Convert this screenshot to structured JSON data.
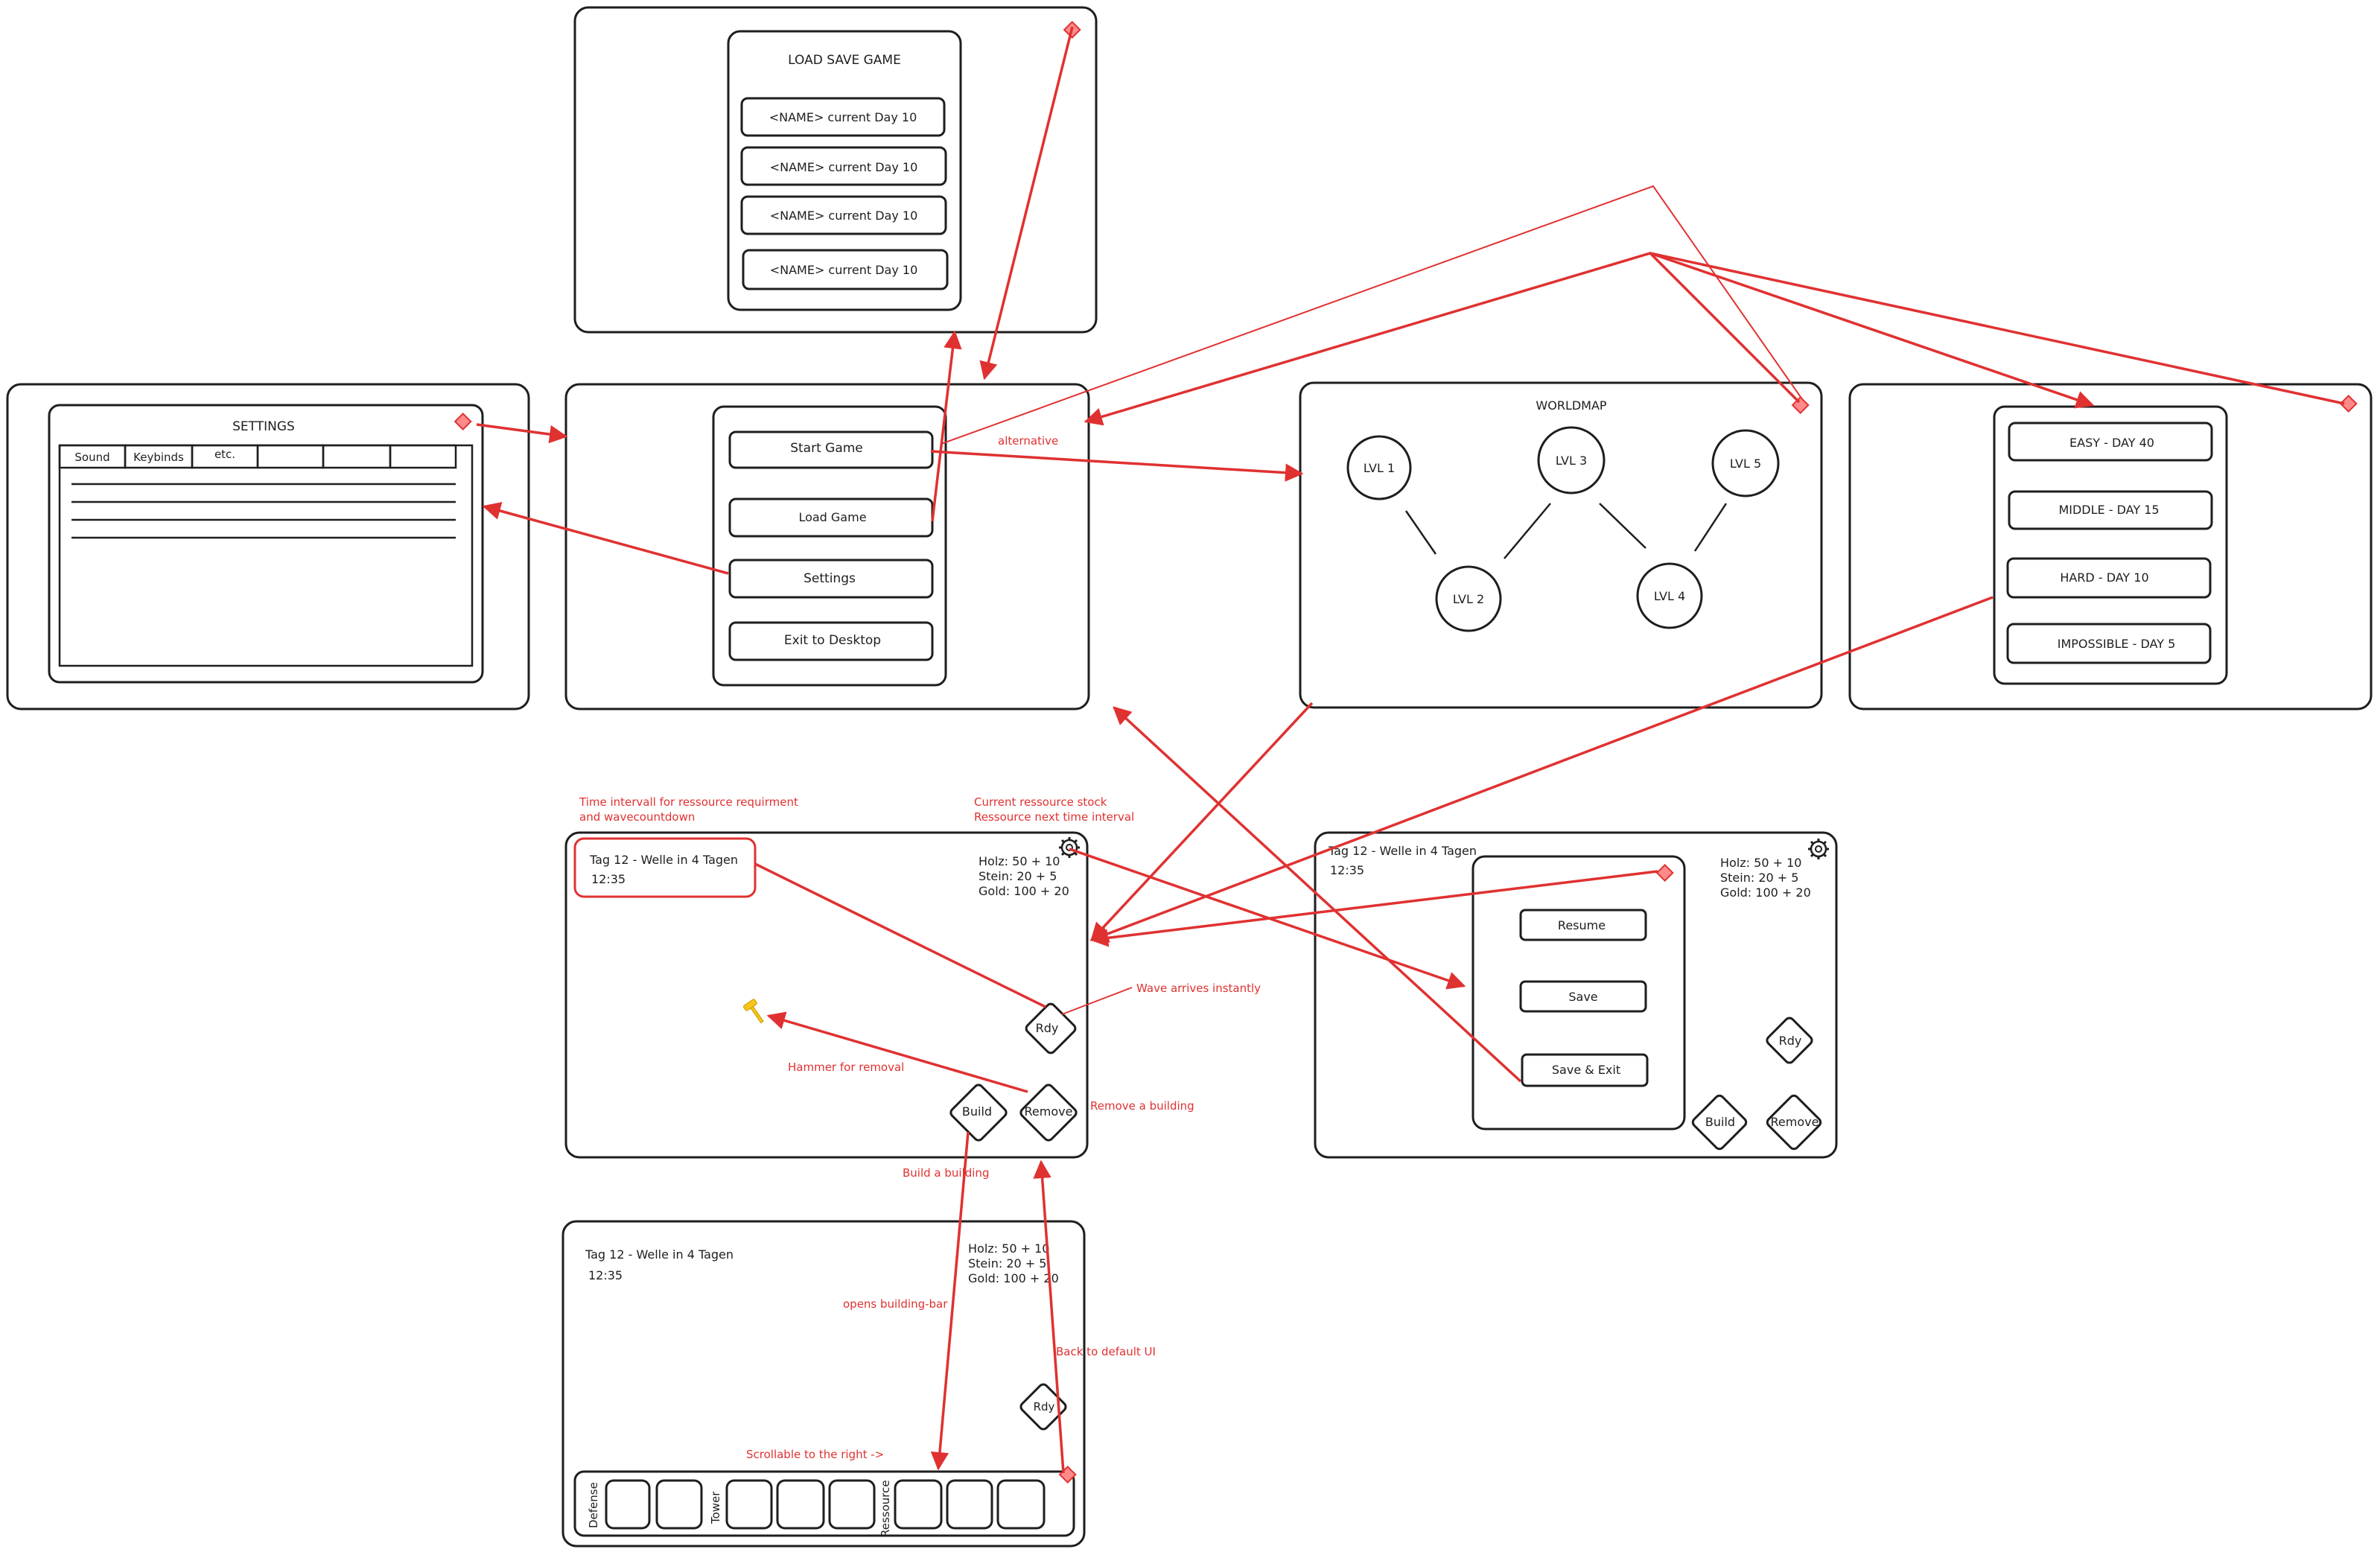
{
  "load_screen": {
    "title": "LOAD SAVE GAME",
    "slots": [
      "<NAME> current Day 10",
      "<NAME> current Day 10",
      "<NAME> current Day 10",
      "<NAME> current Day 10"
    ]
  },
  "settings_screen": {
    "title": "SETTINGS",
    "tabs": [
      "Sound",
      "Keybinds",
      "etc.",
      "",
      "",
      ""
    ]
  },
  "main_menu": {
    "buttons": [
      "Start Game",
      "Load Game",
      "Settings",
      "Exit to Desktop"
    ]
  },
  "worldmap": {
    "title": "WORLDMAP",
    "levels": [
      "LVL 1",
      "LVL 2",
      "LVL 3",
      "LVL 4",
      "LVL 5"
    ]
  },
  "difficulty": {
    "options": [
      "EASY - DAY 40",
      "MIDDLE - DAY 15",
      "HARD - DAY 10",
      "IMPOSSIBLE - DAY 5"
    ]
  },
  "hud": {
    "day_wave": "Tag 12 - Welle in 4 Tagen",
    "time": "12:35",
    "resources": [
      "Holz: 50 + 10",
      "Stein: 20 + 5",
      "Gold: 100 + 20"
    ],
    "rdy_label": "Rdy",
    "build_label": "Build",
    "remove_label": "Remove"
  },
  "pause_menu": {
    "buttons": [
      "Resume",
      "Save",
      "Save & Exit"
    ]
  },
  "building_bar": {
    "categories": [
      "Defense",
      "Tower",
      "Ressource"
    ]
  },
  "annotations": {
    "alternative": "alternative",
    "time_interval_1": "Time intervall for ressource requirment",
    "time_interval_2": "and wavecountdown",
    "resource_stock_1": "Current ressource stock",
    "resource_stock_2": "Ressource next time interval",
    "wave_arrives": "Wave arrives instantly",
    "hammer": "Hammer for removal",
    "remove_building": "Remove a building",
    "build_building": "Build a building",
    "opens_bar": "opens building-bar",
    "back_default": "Back to default UI",
    "scrollable": "Scrollable to the right ->"
  },
  "colors": {
    "ink": "#1e1e1e",
    "accent_red": "#e03131",
    "diamond_fill": "#ff8a8a",
    "hammer_yellow": "#f5c518"
  },
  "icons": [
    "gear-icon",
    "hammer-icon",
    "close-diamond-icon"
  ]
}
